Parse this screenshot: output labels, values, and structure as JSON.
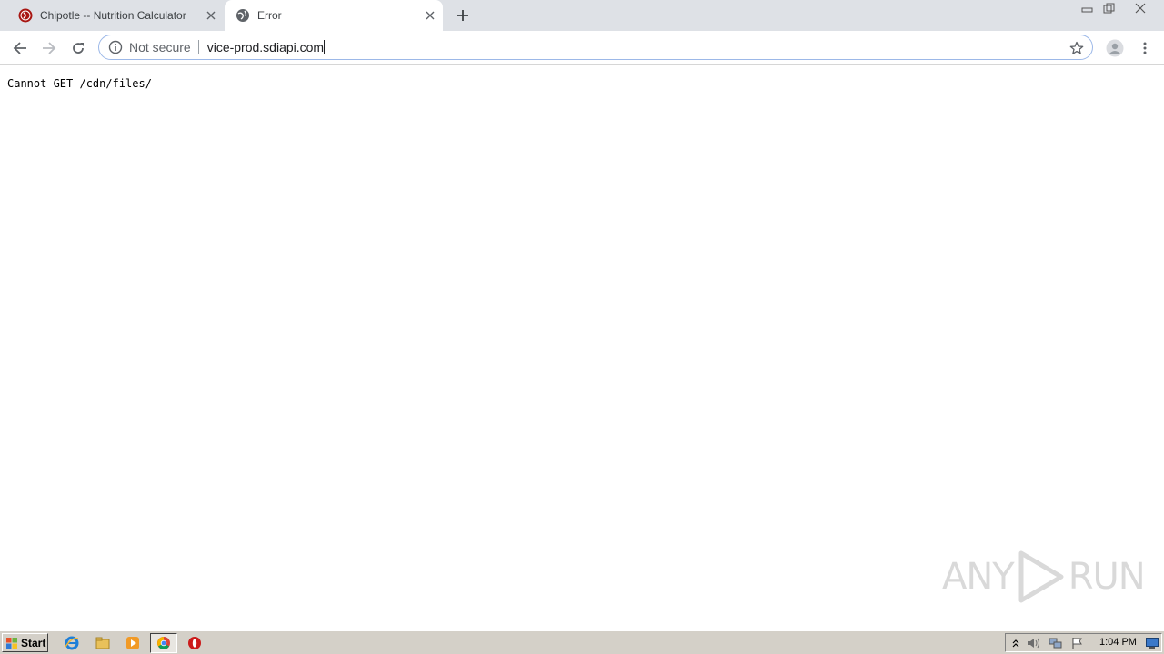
{
  "browser": {
    "tabs": [
      {
        "title": "Chipotle -- Nutrition Calculator",
        "favicon": "chipotle-logo-icon",
        "active": false
      },
      {
        "title": "Error",
        "favicon": "globe-icon",
        "active": true
      }
    ],
    "address_bar": {
      "security_label": "Not secure",
      "url": "vice-prod.sdiapi.com"
    }
  },
  "page": {
    "error_text": "Cannot GET /cdn/files/"
  },
  "watermark": {
    "left": "ANY",
    "right": "RUN"
  },
  "taskbar": {
    "start_label": "Start",
    "clock": "1:04 PM"
  },
  "colors": {
    "tabstrip_bg": "#dee1e6",
    "taskbar_bg": "#d4d0c8",
    "omnibox_border": "#9cb8e8"
  }
}
